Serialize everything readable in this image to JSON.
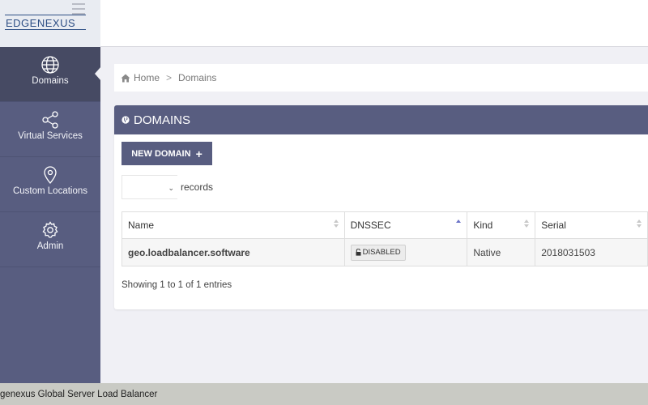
{
  "brand": {
    "logo_part1": "EDGE",
    "logo_part2": "NEXUS"
  },
  "sidebar": {
    "items": [
      {
        "label": "Domains",
        "icon": "globe-icon",
        "active": true
      },
      {
        "label": "Virtual Services",
        "icon": "share-icon",
        "active": false
      },
      {
        "label": "Custom Locations",
        "icon": "map-pin-icon",
        "active": false
      },
      {
        "label": "Admin",
        "icon": "gear-icon",
        "active": false
      }
    ]
  },
  "breadcrumb": {
    "home": "Home",
    "separator": ">",
    "current": "Domains"
  },
  "panel": {
    "title": "DOMAINS",
    "new_button": "NEW DOMAIN",
    "records_label": "records",
    "records_value": ""
  },
  "table": {
    "columns": [
      "Name",
      "DNSSEC",
      "Kind",
      "Serial"
    ],
    "rows": [
      {
        "name": "geo.loadbalancer.software",
        "dnssec": "DISABLED",
        "kind": "Native",
        "serial": "2018031503"
      }
    ],
    "info": "Showing 1 to 1 of 1 entries"
  },
  "footer": {
    "text": "genexus Global Server Load Balancer"
  },
  "colors": {
    "sidebar": "#585d80",
    "sidebar_active": "#464a63",
    "accent": "#585d80",
    "sort_active": "#6b73c7"
  }
}
